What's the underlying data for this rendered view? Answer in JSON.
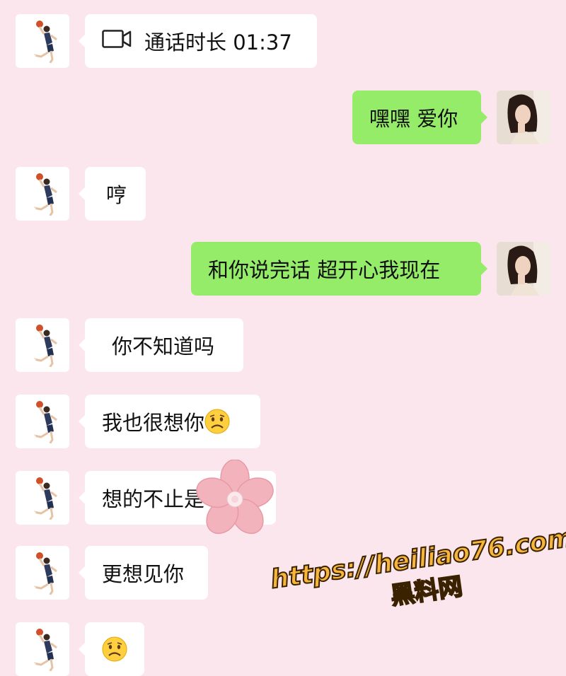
{
  "messages": [
    {
      "side": "in",
      "text": "通话时长 01:37",
      "icon": "video-call-icon"
    },
    {
      "side": "out",
      "text": "嘿嘿 爱你"
    },
    {
      "side": "in",
      "text": "哼"
    },
    {
      "side": "out",
      "text": "和你说完话 超开心我现在"
    },
    {
      "side": "in",
      "text": "你不知道吗"
    },
    {
      "side": "in",
      "text": "我也很想你",
      "emoji": "sad-face-emoji"
    },
    {
      "side": "in",
      "text": "想的不止是"
    },
    {
      "side": "in",
      "text": "更想见你"
    },
    {
      "side": "in",
      "text": "",
      "emoji": "sad-face-emoji"
    }
  ],
  "watermark": {
    "url": "https://heiliao76.com",
    "name": "黑料网"
  },
  "colors": {
    "background": "#fce6ee",
    "incoming_bubble": "#ffffff",
    "outgoing_bubble": "#95ec69",
    "watermark": "#f6b53b"
  }
}
